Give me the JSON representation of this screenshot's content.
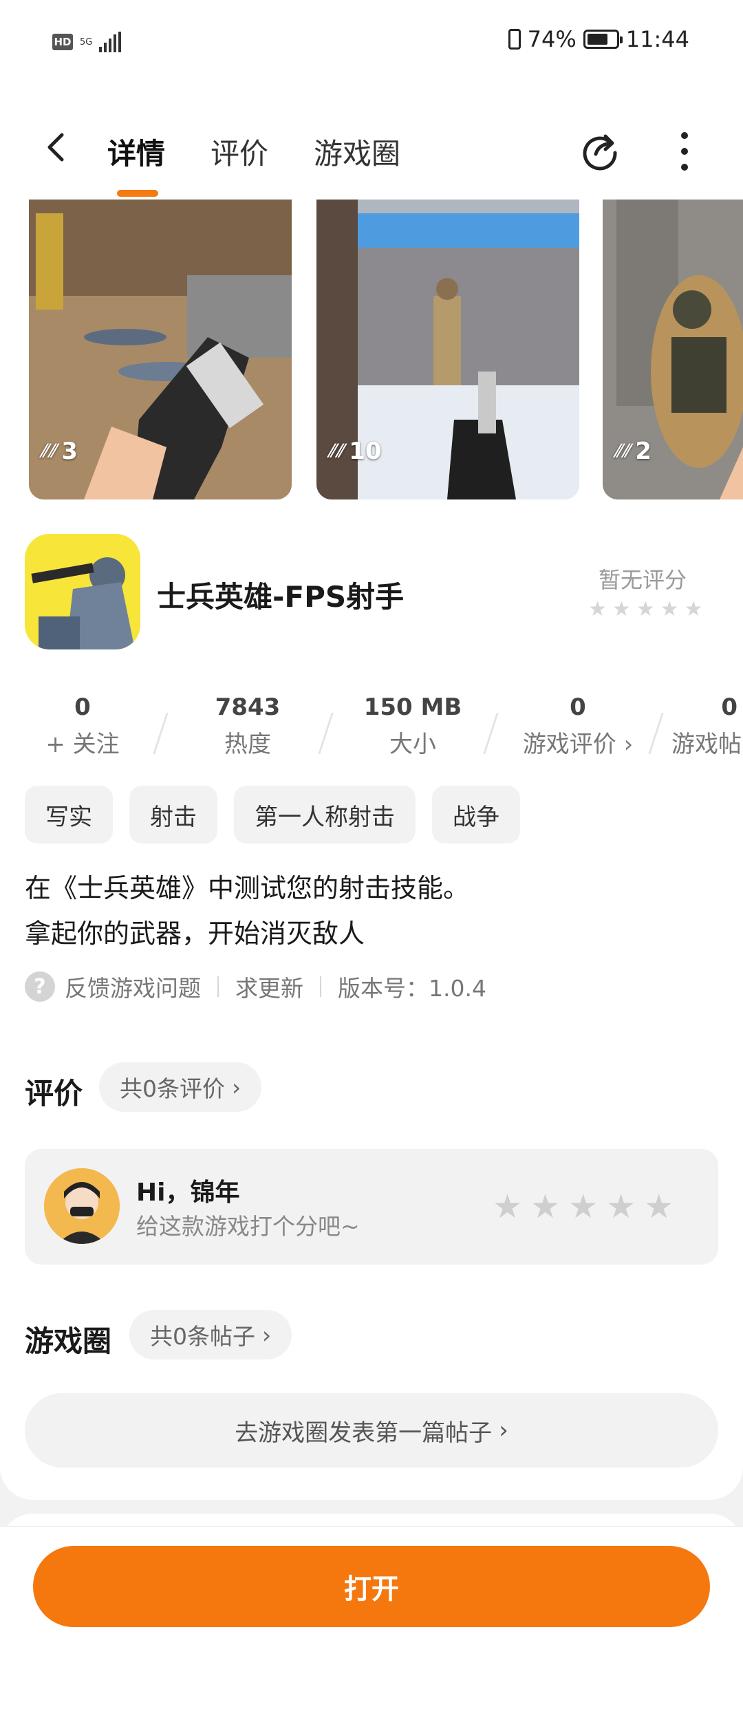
{
  "status_bar": {
    "hd": "HD",
    "network": "5G",
    "battery": "74%",
    "time": "11:44"
  },
  "header": {
    "tabs": [
      {
        "label": "详情"
      },
      {
        "label": "评价"
      },
      {
        "label": "游戏圈"
      }
    ],
    "active_tab": "详情"
  },
  "gallery": {
    "screenshots": [
      {
        "count": "3"
      },
      {
        "count": "10"
      },
      {
        "count": "2"
      }
    ]
  },
  "app": {
    "name": "士兵英雄-FPS射手",
    "rating_text": "暂无评分",
    "rating_stars": 0
  },
  "stats": [
    {
      "value": "0",
      "label": "+ 关注"
    },
    {
      "value": "7843",
      "label": "热度"
    },
    {
      "value": "150 MB",
      "label": "大小"
    },
    {
      "value": "0",
      "label": "游戏评价 ›"
    },
    {
      "value": "0",
      "label": "游戏帖"
    }
  ],
  "tags": [
    "写实",
    "射击",
    "第一人称射击",
    "战争"
  ],
  "description": {
    "line1": "在《士兵英雄》中测试您的射击技能。",
    "line2": "拿起你的武器，开始消灭敌人"
  },
  "meta": {
    "feedback": "反馈游戏问题",
    "update": "求更新",
    "version": "版本号：1.0.4"
  },
  "reviews": {
    "title": "评价",
    "count_pill": "共0条评价",
    "greeting": "Hi，锦年",
    "prompt": "给这款游戏打个分吧~"
  },
  "circle": {
    "title": "游戏圈",
    "count_pill": "共0条帖子",
    "post_button": "去游戏圈发表第一篇帖子"
  },
  "bottom": {
    "open_button": "打开"
  },
  "colors": {
    "accent": "#f5780f",
    "background": "#f2f2f2"
  }
}
